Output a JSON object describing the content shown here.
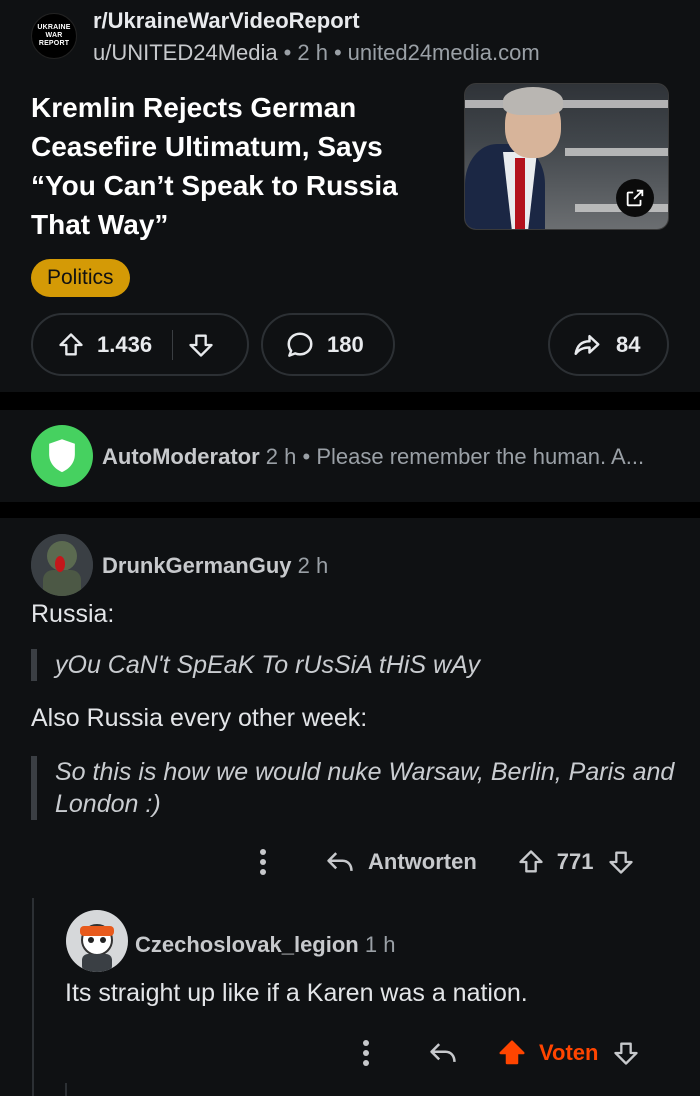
{
  "post": {
    "subreddit_avatar_text": [
      "UKRAINE",
      "WAR REPORT"
    ],
    "subreddit": "r/UkraineWarVideoReport",
    "author": "u/UNITED24Media",
    "age": "2 h",
    "domain": "united24media.com",
    "title": "Kremlin Rejects German Ceasefire Ultimatum, Says “You Can’t Speak to Russia That Way”",
    "flair": "Politics",
    "flair_color": "#d49a06",
    "upvotes": "1.436",
    "comments": "180",
    "shares": "84"
  },
  "automod": {
    "name": "AutoModerator",
    "age": "2 h",
    "preview": "Please remember the human. A..."
  },
  "comment1": {
    "author": "DrunkGermanGuy",
    "age": "2 h",
    "line1": "Russia:",
    "quote1": "yOu CaN't SpEaK To rUsSiA tHiS wAy",
    "line2": "Also Russia every other week:",
    "quote2": "So this is how we would nuke Warsaw, Berlin, Paris and London :)",
    "reply_label": "Antworten",
    "score": "771"
  },
  "comment2": {
    "author": "Czechoslovak_legion",
    "age": "1 h",
    "text": "Its straight up like if a Karen was a nation.",
    "vote_label": "Voten",
    "upvote_color": "#ff4500"
  },
  "icons": [
    "external-link-icon",
    "upvote-icon",
    "downvote-icon",
    "comment-icon",
    "share-icon",
    "shield-icon",
    "more-icon",
    "reply-icon"
  ]
}
